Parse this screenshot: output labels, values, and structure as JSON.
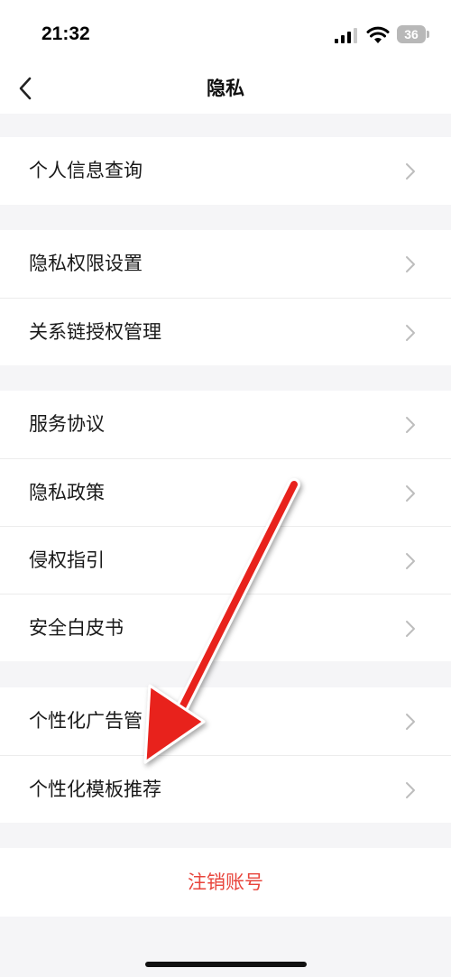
{
  "status_bar": {
    "time": "21:32",
    "battery": "36"
  },
  "header": {
    "title": "隐私"
  },
  "groups": [
    {
      "items": [
        {
          "label": "个人信息查询"
        }
      ]
    },
    {
      "items": [
        {
          "label": "隐私权限设置"
        },
        {
          "label": "关系链授权管理"
        }
      ]
    },
    {
      "items": [
        {
          "label": "服务协议"
        },
        {
          "label": "隐私政策"
        },
        {
          "label": "侵权指引"
        },
        {
          "label": "安全白皮书"
        }
      ]
    },
    {
      "items": [
        {
          "label": "个性化广告管"
        },
        {
          "label": "个性化模板推荐"
        }
      ]
    }
  ],
  "logout_label": "注销账号",
  "colors": {
    "accent_red": "#e8453c",
    "annotation_arrow": "#e8231f"
  },
  "icons": [
    "back-icon",
    "chevron-right-icon",
    "signal-icon",
    "wifi-icon",
    "battery-icon"
  ]
}
